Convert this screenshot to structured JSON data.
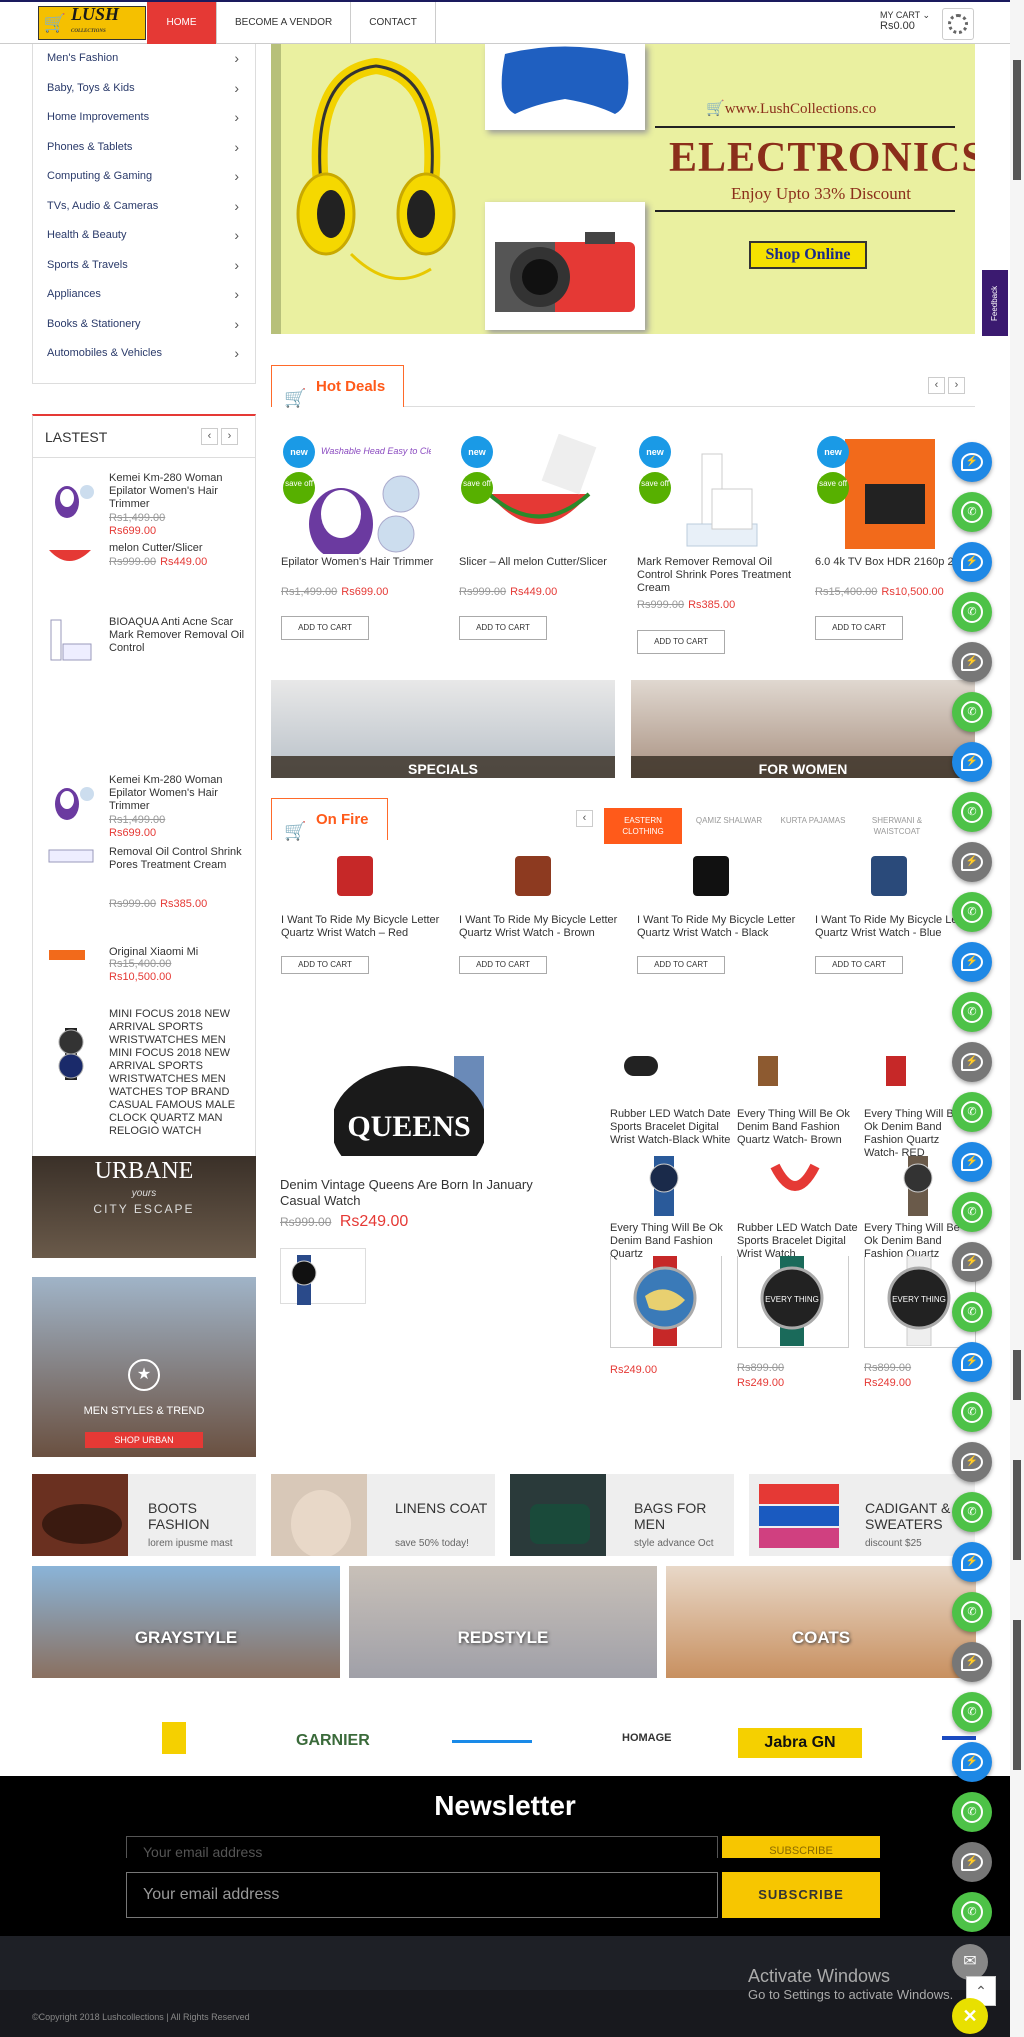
{
  "header": {
    "logo_text": "LUSH",
    "logo_sub": "COLLECTIONS",
    "nav": [
      "HOME",
      "BECOME A VENDOR",
      "CONTACT"
    ],
    "cart_label": "MY CART",
    "cart_amount": "Rs0.00"
  },
  "categories": [
    "Men's Fashion",
    "Baby, Toys & Kids",
    "Home Improvements",
    "Phones & Tablets",
    "Computing & Gaming",
    "TVs, Audio & Cameras",
    "Health & Beauty",
    "Sports & Travels",
    "Appliances",
    "Books & Stationery",
    "Automobiles & Vehicles"
  ],
  "hero": {
    "url": "www.LushCollections.co",
    "title": "ELECTRONICS",
    "subtitle": "Enjoy Upto 33% Discount",
    "button": "Shop Online"
  },
  "feedback": "Feedback",
  "hot_deals": {
    "title": "Hot Deals",
    "products": [
      {
        "name": "Epilator Women's Hair Trimmer",
        "old": "Rs1,499.00",
        "new": "Rs699.00",
        "button": "ADD TO CART",
        "img_text": "Washable Head Easy to Clean"
      },
      {
        "name": "Slicer – All melon Cutter/Slicer",
        "old": "Rs999.00",
        "new": "Rs449.00",
        "button": "ADD TO CART"
      },
      {
        "name": "Mark Remover Removal Oil Control Shrink Pores Treatment Cream",
        "old": "Rs999.00",
        "new": "Rs385.00",
        "button": "ADD TO CART"
      },
      {
        "name": "6.0 4k TV Box HDR 2160p 2016",
        "old": "Rs15,400.00",
        "new": "Rs10,500.00",
        "button": "ADD TO CART"
      }
    ],
    "badge_new": "new",
    "badge_save": "save off"
  },
  "lastest": {
    "title": "LASTEST",
    "items": [
      {
        "name": "Kemei Km-280 Woman Epilator Women's Hair Trimmer",
        "old": "Rs1,499.00",
        "new": "Rs699.00"
      },
      {
        "name": "melon Cutter/Slicer",
        "old": "Rs999.00",
        "new": "Rs449.00"
      },
      {
        "name": "BIOAQUA Anti Acne Scar Mark Remover Removal Oil Control",
        "old": "",
        "new": ""
      },
      {
        "name": "Kemei Km-280 Woman Epilator Women's Hair Trimmer",
        "old": "Rs1,499.00",
        "new": "Rs699.00"
      },
      {
        "name": "Removal Oil Control Shrink Pores Treatment Cream",
        "old": "Rs999.00",
        "new": "Rs385.00"
      },
      {
        "name": "Original Xiaomi Mi",
        "old": "Rs15,400.00",
        "new": "Rs10,500.00"
      },
      {
        "name": "MINI FOCUS 2018 NEW ARRIVAL SPORTS WRISTWATCHES MEN MINI FOCUS 2018 NEW ARRIVAL SPORTS WRISTWATCHES MEN WATCHES TOP BRAND CASUAL FAMOUS MALE CLOCK QUARTZ MAN RELOGIO WATCH",
        "old": "",
        "new": ""
      }
    ]
  },
  "promos": {
    "specials": "SPECIALS",
    "for_women": "FOR WOMEN",
    "urbane_title": "URBANE",
    "urbane_yours": "yours",
    "urbane_sub": "CITY ESCAPE",
    "men_styles": "MEN STYLES & TREND",
    "shop_urban": "SHOP URBAN"
  },
  "on_fire": {
    "title": "On Fire",
    "tabs": [
      "EASTERN CLOTHING",
      "QAMIZ SHALWAR",
      "KURTA PAJAMAS",
      "SHERWANI & WAISTCOAT"
    ],
    "products": [
      {
        "name": "I Want To Ride My Bicycle Letter Quartz Wrist Watch – Red",
        "button": "ADD TO CART"
      },
      {
        "name": "I Want To Ride My Bicycle Letter Quartz Wrist Watch - Brown",
        "button": "ADD TO CART"
      },
      {
        "name": "I Want To Ride My Bicycle Letter Quartz Wrist Watch - Black",
        "button": "ADD TO CART"
      },
      {
        "name": "I Want To Ride My Bicycle Letter Quartz Wrist Watch - Blue",
        "button": "ADD TO CART"
      }
    ]
  },
  "featured": {
    "name": "Denim Vintage Queens Are Born In January Casual Watch",
    "old": "Rs999.00",
    "new": "Rs249.00",
    "img_text": "QUEENS"
  },
  "grid": [
    {
      "name": "Rubber LED Watch Date Sports Bracelet Digital Wrist Watch-Black White"
    },
    {
      "name": "Every Thing Will Be Ok Denim Band Fashion Quartz Watch- Brown"
    },
    {
      "name": "Every Thing Will Be Ok Denim Band Fashion Quartz Watch- RED"
    },
    {
      "name": "Every Thing Will Be Ok Denim Band Fashion Quartz"
    },
    {
      "name": "Rubber LED Watch Date Sports Bracelet Digital Wrist Watch"
    },
    {
      "name": "Every Thing Will Be Ok Denim Band Fashion Quartz"
    }
  ],
  "grid_prices": [
    {
      "old": "",
      "new": "Rs249.00"
    },
    {
      "old": "Rs899.00",
      "new": "Rs249.00"
    },
    {
      "old": "Rs899.00",
      "new": "Rs249.00"
    }
  ],
  "cat_strips": [
    {
      "title": "BOOTS FASHION",
      "sub": "lorem ipusme mast"
    },
    {
      "title": "LINENS COAT",
      "sub": "save 50% today!"
    },
    {
      "title": "BAGS FOR MEN",
      "sub": "style advance Oct"
    },
    {
      "title": "CADIGANT & SWEATERS",
      "sub": "discount $25"
    }
  ],
  "big_cats": [
    "GRAYSTYLE",
    "REDSTYLE",
    "COATS"
  ],
  "brands": [
    "GARNIER",
    "HOMAGE",
    "Jabra GN"
  ],
  "newsletter": {
    "title": "Newsletter",
    "placeholder": "Your email address",
    "button": "SUBSCRIBE"
  },
  "footer": {
    "copyright": "©Copyright 2018 Lushcollections | All Rights Reserved",
    "activate_title": "Activate Windows",
    "activate_sub": "Go to Settings to activate Windows."
  },
  "colors": {
    "accent": "#e53935",
    "orange": "#ff5a1a",
    "whatsapp": "#4dc247",
    "messenger": "#1e88e5"
  }
}
